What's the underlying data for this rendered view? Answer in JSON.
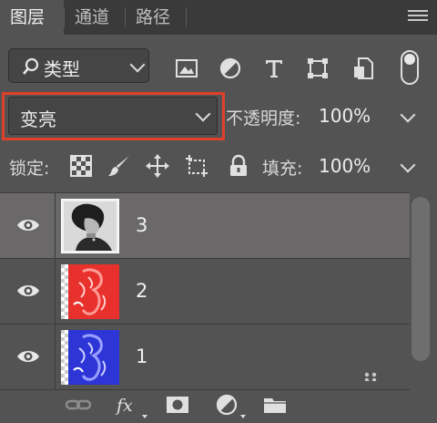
{
  "tabs": [
    {
      "label": "图层",
      "active": true
    },
    {
      "label": "通道",
      "active": false
    },
    {
      "label": "路径",
      "active": false
    }
  ],
  "filter": {
    "kind_label": "类型",
    "icons": [
      "image-filter-icon",
      "adjustment-filter-icon",
      "type-filter-icon",
      "shape-filter-icon",
      "smart-object-filter-icon"
    ]
  },
  "blend": {
    "mode": "变亮",
    "opacity_label": "不透明度:",
    "opacity_value": "100%"
  },
  "lock": {
    "label": "锁定:",
    "fill_label": "填充:",
    "fill_value": "100%"
  },
  "layers": [
    {
      "name": "3",
      "selected": true
    },
    {
      "name": "2",
      "selected": false
    },
    {
      "name": "1",
      "selected": false
    }
  ],
  "colors": {
    "panel_bg": "#535353",
    "tab_bar_bg": "#3a3a3a",
    "selected_row": "#6a6869",
    "highlight_border": "#e0402a",
    "layer2_tint": "#e8312c",
    "layer1_tint": "#2d35d6"
  }
}
